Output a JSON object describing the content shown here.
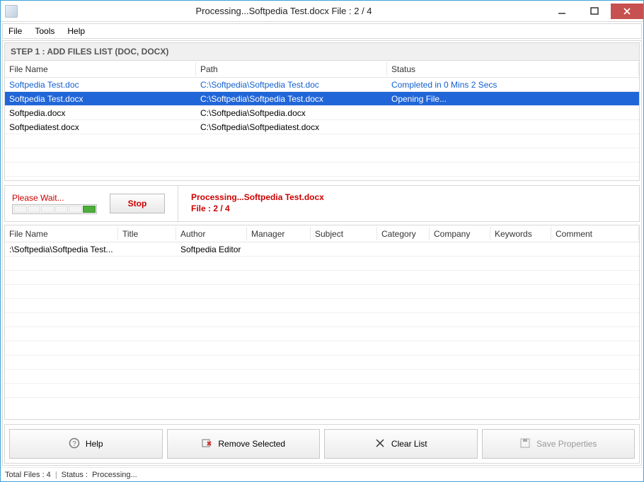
{
  "window": {
    "title": "Processing...Softpedia Test.docx File : 2 / 4"
  },
  "menu": {
    "file": "File",
    "tools": "Tools",
    "help": "Help"
  },
  "step_header": "STEP 1 : ADD FILES LIST (DOC, DOCX)",
  "table1": {
    "headers": {
      "filename": "File Name",
      "path": "Path",
      "status": "Status"
    },
    "rows": [
      {
        "filename": "Softpedia Test.doc",
        "path": "C:\\Softpedia\\Softpedia Test.doc",
        "status": "Completed in 0 Mins 2 Secs",
        "state": "completed"
      },
      {
        "filename": "Softpedia Test.docx",
        "path": "C:\\Softpedia\\Softpedia Test.docx",
        "status": "Opening File...",
        "state": "selected"
      },
      {
        "filename": "Softpedia.docx",
        "path": "C:\\Softpedia\\Softpedia.docx",
        "status": "",
        "state": ""
      },
      {
        "filename": "Softpediatest.docx",
        "path": "C:\\Softpedia\\Softpediatest.docx",
        "status": "",
        "state": ""
      }
    ]
  },
  "progress": {
    "wait_label": "Please Wait...",
    "stop_label": "Stop",
    "line1": "Processing...Softpedia Test.docx",
    "line2": "File : 2 / 4"
  },
  "table2": {
    "headers": {
      "filename": "File Name",
      "title": "Title",
      "author": "Author",
      "manager": "Manager",
      "subject": "Subject",
      "category": "Category",
      "company": "Company",
      "keywords": "Keywords",
      "comment": "Comment"
    },
    "rows": [
      {
        "filename": ":\\Softpedia\\Softpedia Test...",
        "title": "",
        "author": "Softpedia Editor",
        "manager": "",
        "subject": "",
        "category": "",
        "company": "",
        "keywords": "",
        "comment": ""
      }
    ]
  },
  "buttons": {
    "help": "Help",
    "remove_selected": "Remove Selected",
    "clear_list": "Clear List",
    "save_properties": "Save Properties"
  },
  "statusbar": {
    "total_files": "Total Files : 4",
    "status_label": "Status :",
    "status_value": "Processing..."
  }
}
